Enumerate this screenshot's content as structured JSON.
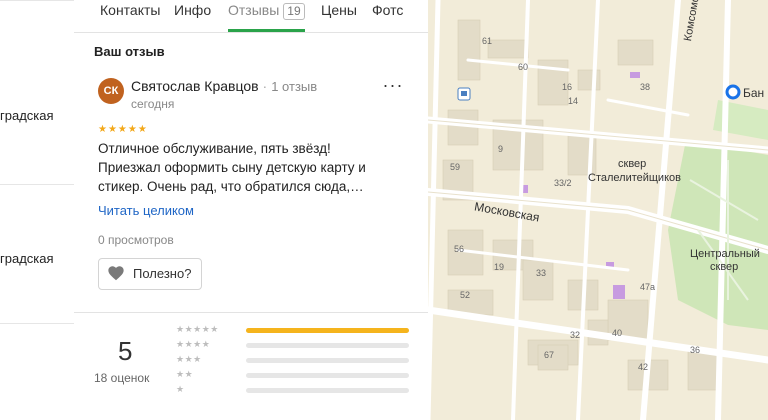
{
  "left_list": {
    "items": [
      {
        "text": "градская"
      },
      {
        "text": "градская"
      }
    ]
  },
  "tabs": [
    {
      "label": "Контакты"
    },
    {
      "label": "Инфо"
    },
    {
      "label": "Отзывы",
      "count": "19"
    },
    {
      "label": "Цены"
    },
    {
      "label": "Фотс"
    }
  ],
  "review": {
    "section_title": "Ваш отзыв",
    "avatar_initials": "СК",
    "author": "Святослав Кравцов",
    "author_reviews": "1 отзыв",
    "date": "сегодня",
    "stars": "★★★★★",
    "rating": 5,
    "text_line1": "Отличное обслуживание, пять звёзд!",
    "text_line2": "Приезжал оформить сыну детскую карту и",
    "text_line3": "стикер. Очень рад, что обратился сюда,…",
    "read_more": "Читать целиком",
    "views": "0 просмотров",
    "useful": "Полезно?",
    "more_menu": "···"
  },
  "summary": {
    "rating": "5",
    "count_label": "18 оценок",
    "rows": [
      {
        "stars": "★★★★★",
        "fraction": 1.0
      },
      {
        "stars": "★★★★",
        "fraction": 0
      },
      {
        "stars": "★★★",
        "fraction": 0
      },
      {
        "stars": "★★",
        "fraction": 0
      },
      {
        "stars": "★",
        "fraction": 0
      }
    ]
  },
  "map": {
    "street_labels": {
      "moskovskaya": "Московская",
      "komsomolskaya": "Комсомольская",
      "skver_1": "сквер",
      "skver_2": "Сталелитейщиков",
      "central_1": "Центральный",
      "central_2": "сквер",
      "ban": "Бан"
    },
    "building_numbers": [
      "61",
      "60",
      "16",
      "14",
      "38",
      "9",
      "59",
      "33/2",
      "56",
      "19",
      "33",
      "52",
      "47a",
      "40",
      "32",
      "67",
      "42",
      "36"
    ],
    "colors": {
      "park": "#cfe6b8",
      "road": "#ffffff",
      "building": "#e6dfcc",
      "accent_blue": "#1a73e8"
    }
  }
}
